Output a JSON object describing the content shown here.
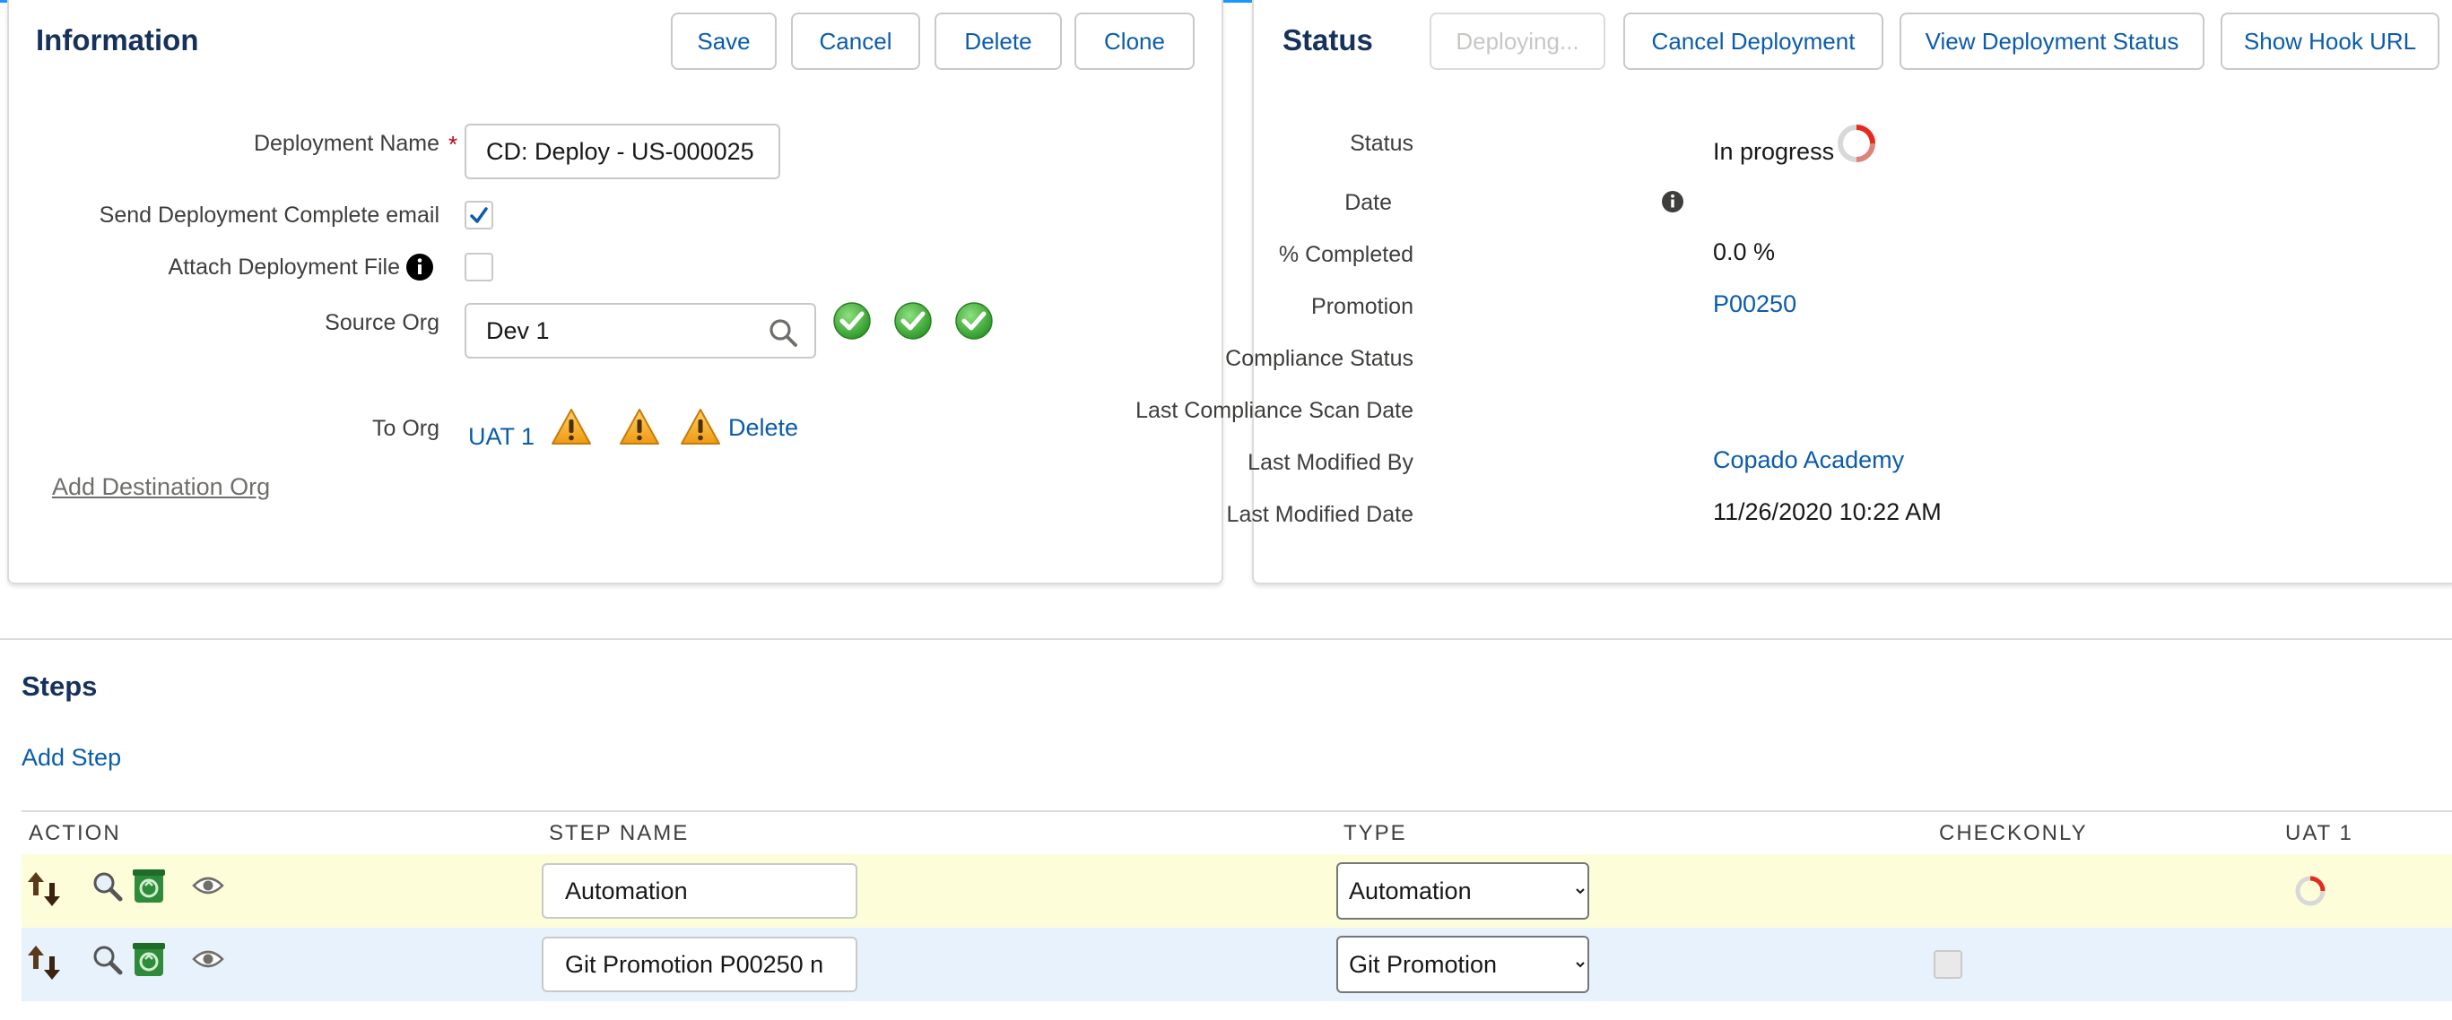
{
  "info": {
    "title": "Information",
    "buttons": {
      "save": "Save",
      "cancel": "Cancel",
      "delete": "Delete",
      "clone": "Clone"
    },
    "deployment_name_label": "Deployment Name",
    "required_mark": "*",
    "deployment_name_value": "CD: Deploy - US-000025",
    "send_email_label": "Send Deployment Complete email",
    "send_email_checked": true,
    "attach_file_label": "Attach Deployment File",
    "attach_file_checked": false,
    "source_org_label": "Source Org",
    "source_org_value": "Dev 1",
    "to_org_label": "To Org",
    "to_org_value": "UAT 1",
    "to_org_delete": "Delete",
    "add_destination": "Add Destination Org"
  },
  "status": {
    "title": "Status",
    "buttons": {
      "deploying": "Deploying...",
      "cancel_deployment": "Cancel Deployment",
      "view_status": "View Deployment Status",
      "show_hook": "Show Hook URL"
    },
    "fields": {
      "status_label": "Status",
      "status_value": "In progress",
      "date_label": "Date",
      "completed_label": "% Completed",
      "completed_value": "0.0 %",
      "promotion_label": "Promotion",
      "promotion_value": "P00250",
      "compliance_label": "Compliance Status",
      "last_scan_label": "Last Compliance Scan Date",
      "modified_by_label": "Last Modified By",
      "modified_by_value": "Copado Academy",
      "modified_date_label": "Last Modified Date",
      "modified_date_value": "11/26/2020 10:22 AM"
    }
  },
  "steps": {
    "title": "Steps",
    "add_step": "Add Step",
    "columns": {
      "action": "ACTION",
      "step_name": "STEP NAME",
      "type": "TYPE",
      "checkonly": "CHECKONLY",
      "org": "UAT 1"
    },
    "rows": [
      {
        "name": "Automation",
        "type": "Automation"
      },
      {
        "name": "Git Promotion P00250 n",
        "type": "Git Promotion"
      }
    ],
    "type_options": [
      "Automation",
      "Git Promotion"
    ]
  },
  "colors": {
    "accent": "#0b5cab",
    "title": "#16325c",
    "row_yellow": "#fdfdd9",
    "row_blue": "#e8f2fd",
    "success_green": "#4bb344",
    "warning_orange": "#f4a82c",
    "progress_red": "#e62b1e"
  }
}
